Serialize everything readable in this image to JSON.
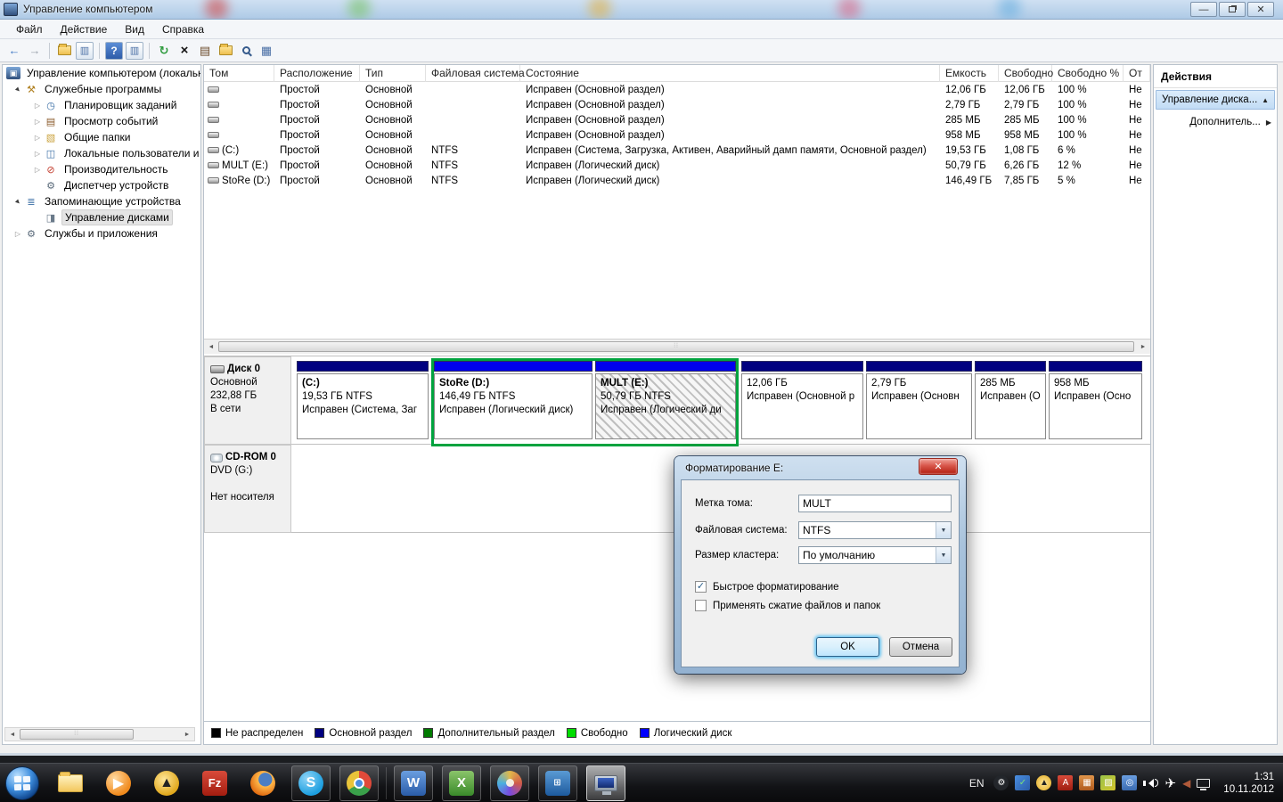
{
  "window": {
    "title": "Управление компьютером",
    "menu": {
      "file": "Файл",
      "action": "Действие",
      "view": "Вид",
      "help": "Справка"
    }
  },
  "tree": {
    "root": "Управление компьютером (локальн",
    "items": [
      {
        "label": "Служебные программы"
      },
      {
        "label": "Планировщик заданий"
      },
      {
        "label": "Просмотр событий"
      },
      {
        "label": "Общие папки"
      },
      {
        "label": "Локальные пользователи и г"
      },
      {
        "label": "Производительность"
      },
      {
        "label": "Диспетчер устройств"
      },
      {
        "label": "Запоминающие устройства"
      },
      {
        "label": "Управление дисками"
      },
      {
        "label": "Службы и приложения"
      }
    ]
  },
  "volumes": {
    "headers": {
      "volume": "Том",
      "layout": "Расположение",
      "type": "Тип",
      "fs": "Файловая система",
      "status": "Состояние",
      "capacity": "Емкость",
      "free": "Свободно",
      "free_pct": "Свободно %",
      "fault": "От"
    },
    "rows": [
      {
        "name": "",
        "layout": "Простой",
        "type": "Основной",
        "fs": "",
        "status": "Исправен (Основной раздел)",
        "capacity": "12,06 ГБ",
        "free": "12,06 ГБ",
        "free_pct": "100 %",
        "fault": "Не"
      },
      {
        "name": "",
        "layout": "Простой",
        "type": "Основной",
        "fs": "",
        "status": "Исправен (Основной раздел)",
        "capacity": "2,79 ГБ",
        "free": "2,79 ГБ",
        "free_pct": "100 %",
        "fault": "Не"
      },
      {
        "name": "",
        "layout": "Простой",
        "type": "Основной",
        "fs": "",
        "status": "Исправен (Основной раздел)",
        "capacity": "285 МБ",
        "free": "285 МБ",
        "free_pct": "100 %",
        "fault": "Не"
      },
      {
        "name": "",
        "layout": "Простой",
        "type": "Основной",
        "fs": "",
        "status": "Исправен (Основной раздел)",
        "capacity": "958 МБ",
        "free": "958 МБ",
        "free_pct": "100 %",
        "fault": "Не"
      },
      {
        "name": "(C:)",
        "layout": "Простой",
        "type": "Основной",
        "fs": "NTFS",
        "status": "Исправен (Система, Загрузка, Активен, Аварийный дамп памяти, Основной раздел)",
        "capacity": "19,53 ГБ",
        "free": "1,08 ГБ",
        "free_pct": "6 %",
        "fault": "Не"
      },
      {
        "name": "MULT (E:)",
        "layout": "Простой",
        "type": "Основной",
        "fs": "NTFS",
        "status": "Исправен (Логический диск)",
        "capacity": "50,79 ГБ",
        "free": "6,26 ГБ",
        "free_pct": "12 %",
        "fault": "Не"
      },
      {
        "name": "StoRe (D:)",
        "layout": "Простой",
        "type": "Основной",
        "fs": "NTFS",
        "status": "Исправен (Логический диск)",
        "capacity": "146,49 ГБ",
        "free": "7,85 ГБ",
        "free_pct": "5 %",
        "fault": "Не"
      }
    ]
  },
  "disk0": {
    "name": "Диск 0",
    "kind": "Основной",
    "size": "232,88 ГБ",
    "status": "В сети",
    "partitions": [
      {
        "label": "(C:)",
        "size": "19,53 ГБ NTFS",
        "status": "Исправен (Система, Заг",
        "color": "#000080"
      },
      {
        "label": "StoRe  (D:)",
        "size": "146,49 ГБ NTFS",
        "status": "Исправен (Логический диск)",
        "color": "#0000ee"
      },
      {
        "label": "MULT  (E:)",
        "size": "50,79 ГБ NTFS",
        "status": "Исправен (Логический ди",
        "color": "#0000ee"
      },
      {
        "label": "",
        "size": "12,06 ГБ",
        "status": "Исправен (Основной р",
        "color": "#000080"
      },
      {
        "label": "",
        "size": "2,79 ГБ",
        "status": "Исправен (Основн",
        "color": "#000080"
      },
      {
        "label": "",
        "size": "285 МБ",
        "status": "Исправен (О",
        "color": "#000080"
      },
      {
        "label": "",
        "size": "958 МБ",
        "status": "Исправен (Осно",
        "color": "#000080"
      }
    ]
  },
  "cdrom": {
    "name": "CD-ROM 0",
    "line2": "DVD (G:)",
    "status": "Нет носителя"
  },
  "legend": {
    "items": [
      {
        "label": "Не распределен",
        "color": "#000000"
      },
      {
        "label": "Основной раздел",
        "color": "#000080"
      },
      {
        "label": "Дополнительный раздел",
        "color": "#007a00"
      },
      {
        "label": "Свободно",
        "color": "#00dd00"
      },
      {
        "label": "Логический диск",
        "color": "#0000ff"
      }
    ]
  },
  "actions": {
    "title": "Действия",
    "primary": "Управление диска...",
    "secondary": "Дополнитель..."
  },
  "dialog": {
    "title": "Форматирование E:",
    "label_volume": "Метка тома:",
    "value_volume": "MULT",
    "label_fs": "Файловая система:",
    "value_fs": "NTFS",
    "label_cluster": "Размер кластера:",
    "value_cluster": "По умолчанию",
    "cb_quick": "Быстрое форматирование",
    "cb_quick_mark": "✓",
    "cb_compress": "Применять сжатие файлов и папок",
    "cb_compress_mark": "",
    "ok": "OK",
    "cancel": "Отмена"
  },
  "taskbar": {
    "tray_lang": "EN",
    "clock_time": "1:31",
    "clock_date": "10.11.2012"
  }
}
